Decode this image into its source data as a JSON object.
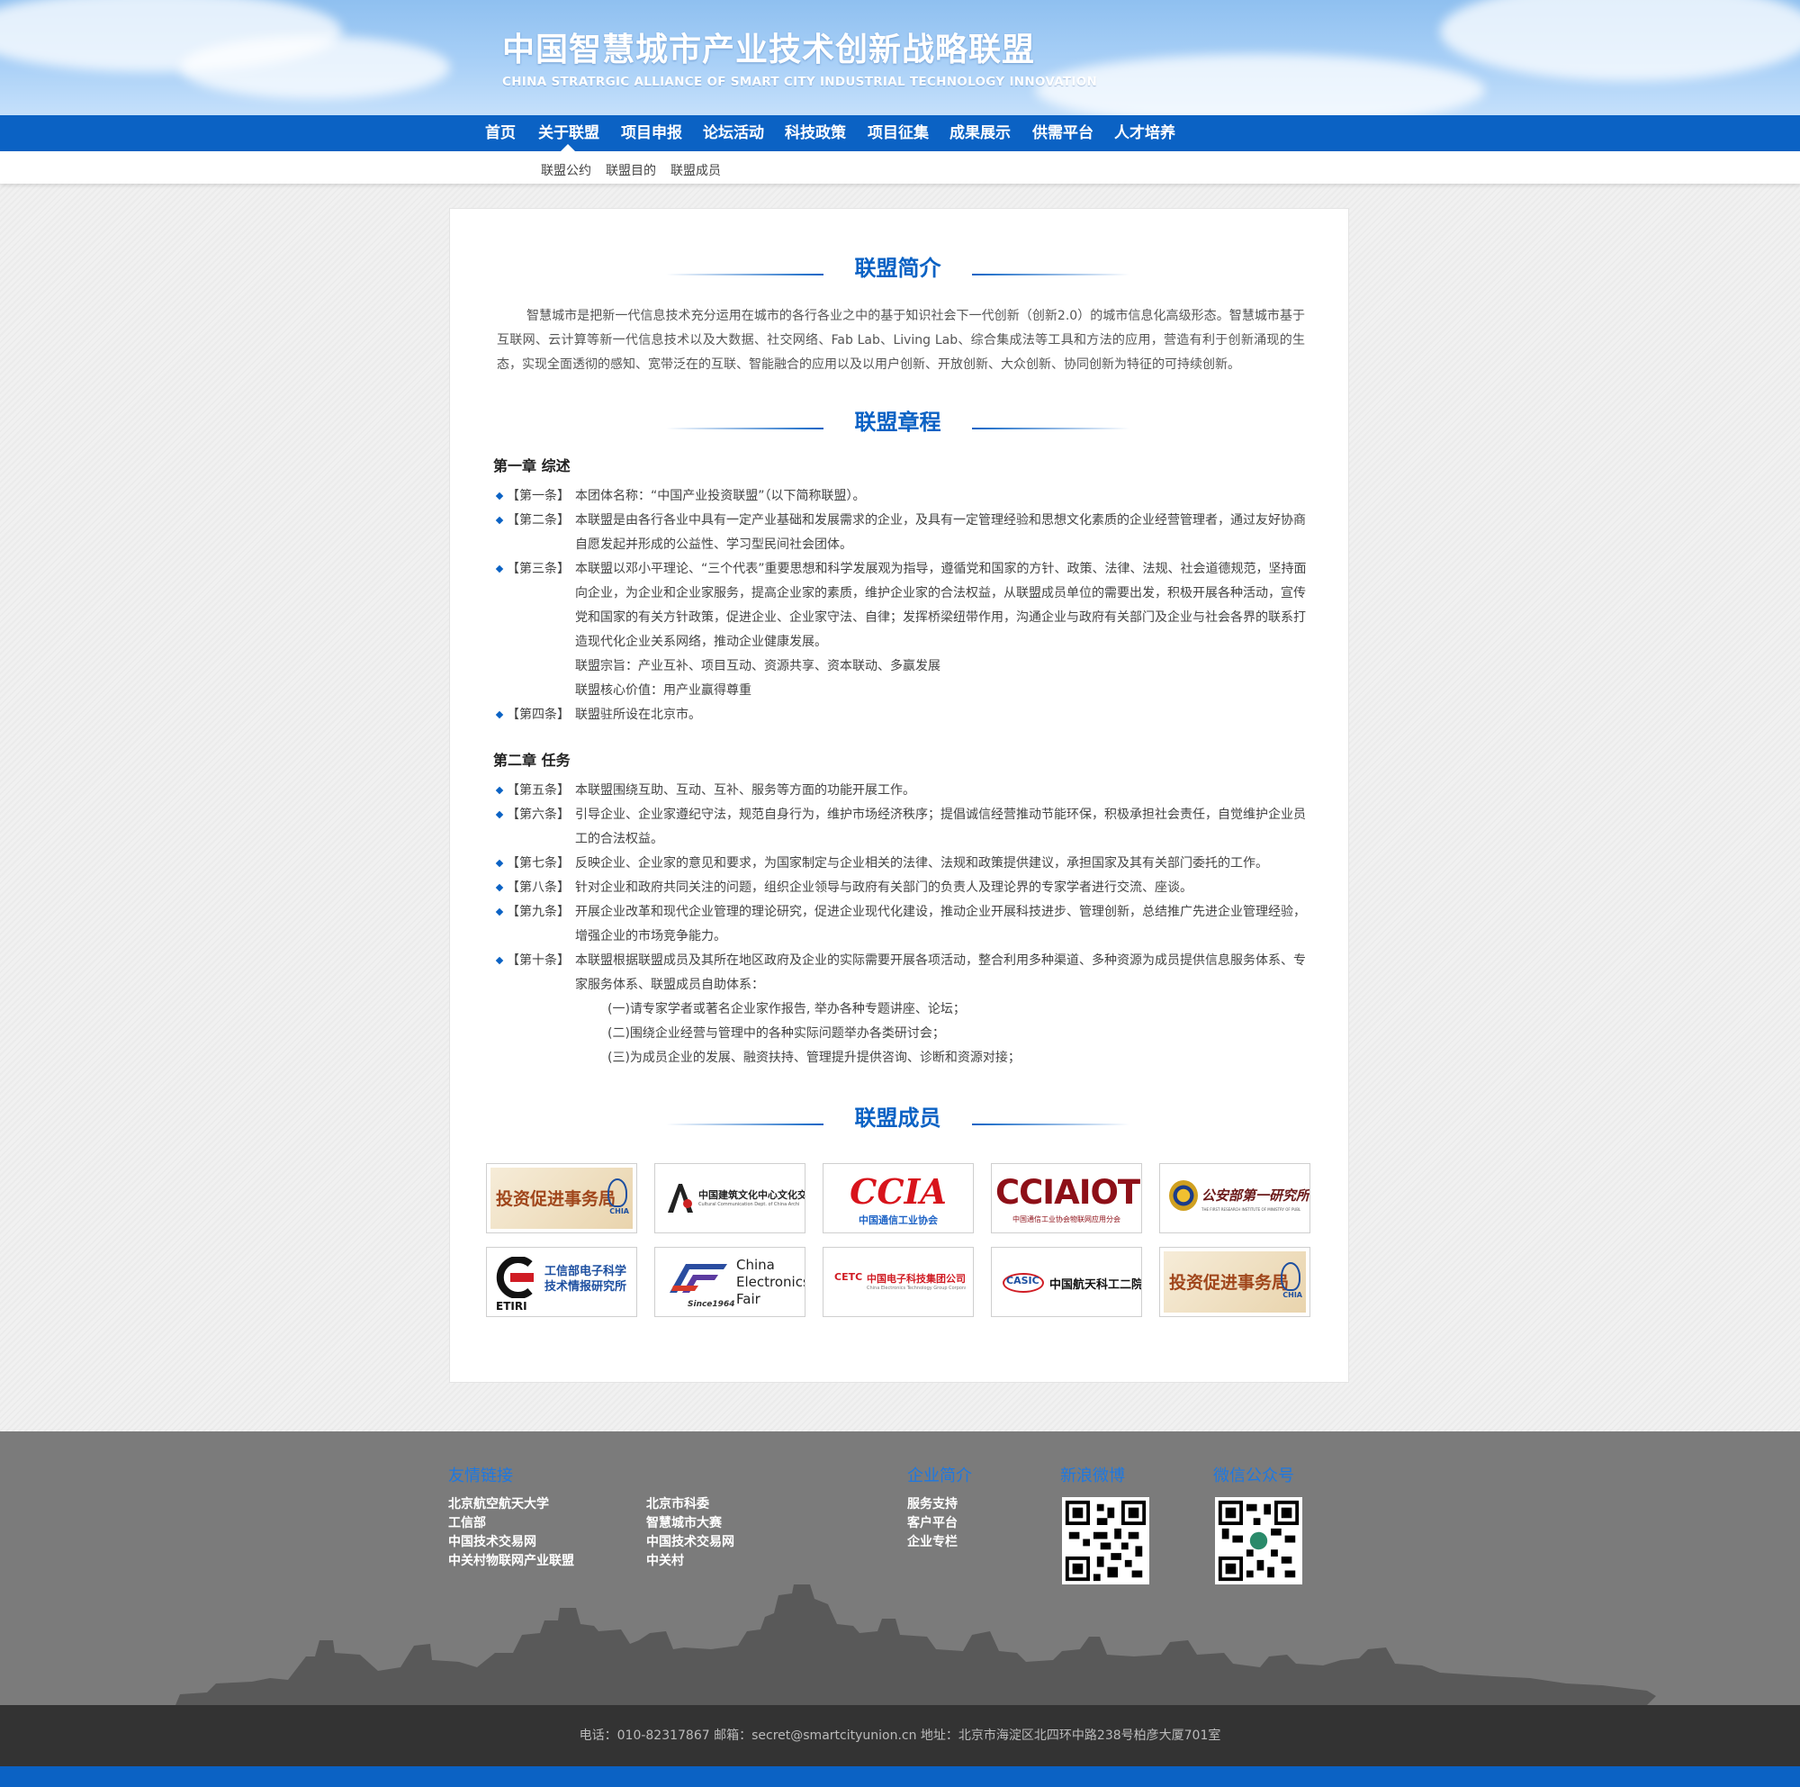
{
  "header": {
    "title": "中国智慧城市产业技术创新战略联盟",
    "subtitle": "CHINA STRATRGIC ALLIANCE OF SMART CITY INDUSTRIAL TECHNOLOGY INNOVATION"
  },
  "nav": {
    "items": [
      "首页",
      "关于联盟",
      "项目申报",
      "论坛活动",
      "科技政策",
      "项目征集",
      "成果展示",
      "供需平台",
      "人才培养"
    ],
    "active": "关于联盟",
    "sub_items": [
      "联盟公约",
      "联盟目的",
      "联盟成员"
    ]
  },
  "intro": {
    "heading": "联盟简介",
    "text": "智慧城市是把新一代信息技术充分运用在城市的各行各业之中的基于知识社会下一代创新（创新2.0）的城市信息化高级形态。智慧城市基于互联网、云计算等新一代信息技术以及大数据、社交网络、Fab Lab、Living Lab、综合集成法等工具和方法的应用，营造有利于创新涌现的生态，实现全面透彻的感知、宽带泛在的互联、智能融合的应用以及以用户创新、开放创新、大众创新、协同创新为特征的可持续创新。"
  },
  "charter": {
    "heading": "联盟章程",
    "chapter1": "第一章  综述",
    "chapter2": "第二章  任务",
    "articles": [
      {
        "num": "【第一条】",
        "text": "本团体名称：“中国产业投资联盟”（以下简称联盟）。"
      },
      {
        "num": "【第二条】",
        "text": "本联盟是由各行各业中具有一定产业基础和发展需求的企业，及具有一定管理经验和思想文化素质的企业经营管理者，通过友好协商自愿发起并形成的公益性、学习型民间社会团体。"
      },
      {
        "num": "【第三条】",
        "text": "本联盟以邓小平理论、“三个代表”重要思想和科学发展观为指导，遵循党和国家的方针、政策、法律、法规、社会道德规范，坚持面向企业，为企业和企业家服务，提高企业家的素质，维护企业家的合法权益，从联盟成员单位的需要出发，积极开展各种活动，宣传党和国家的有关方针政策，促进企业、企业家守法、自律；发挥桥梁纽带作用，沟通企业与政府有关部门及企业与社会各界的联系打造现代化企业关系网络，推动企业健康发展。"
      },
      {
        "num": "【第四条】",
        "text": "联盟驻所设在北京市。"
      },
      {
        "num": "【第五条】",
        "text": "本联盟围绕互助、互动、互补、服务等方面的功能开展工作。"
      },
      {
        "num": "【第六条】",
        "text": "引导企业、企业家遵纪守法，规范自身行为，维护市场经济秩序；提倡诚信经营推动节能环保，积极承担社会责任，自觉维护企业员工的合法权益。"
      },
      {
        "num": "【第七条】",
        "text": "反映企业、企业家的意见和要求，为国家制定与企业相关的法律、法规和政策提供建议，承担国家及其有关部门委托的工作。"
      },
      {
        "num": "【第八条】",
        "text": "针对企业和政府共同关注的问题，组织企业领导与政府有关部门的负责人及理论界的专家学者进行交流、座谈。"
      },
      {
        "num": "【第九条】",
        "text": "开展企业改革和现代企业管理的理论研究，促进企业现代化建设，推动企业开展科技进步、管理创新，总结推广先进企业管理经验，增强企业的市场竞争能力。"
      },
      {
        "num": "【第十条】",
        "text": "本联盟根据联盟成员及其所在地区政府及企业的实际需要开展各项活动，整合利用多种渠道、多种资源为成员提供信息服务体系、专家服务体系、联盟成员自助体系："
      }
    ],
    "purpose": "联盟宗旨：产业互补、项目互动、资源共享、资本联动、多赢发展",
    "core_value": "联盟核心价值：用产业赢得尊重",
    "sub_items": [
      "(一)请专家学者或著名企业家作报告, 举办各种专题讲座、论坛；",
      "(二)围绕企业经营与管理中的各种实际问题举办各类研讨会；",
      "(三)为成员企业的发展、融资扶持、管理提升提供咨询、诊断和资源对接；"
    ]
  },
  "members": {
    "heading": "联盟成员",
    "logos": [
      {
        "name": "投资促进事务局",
        "text": "投资促进事务局",
        "small": "CHIA"
      },
      {
        "name": "中国建筑文化中心",
        "text": "中国建筑文化中心文化交流部",
        "small": "Cultural Communication Dept. of China Architectural Culture Center"
      },
      {
        "name": "中国通信工业协会",
        "text": "CCIA",
        "small": "中国通信工业协会"
      },
      {
        "name": "中国通信工业协会物联网应用分会",
        "text": "CCIAIOT",
        "small": "中国通信工业协会物联网应用分会"
      },
      {
        "name": "公安部第一研究所",
        "text": "公安部第一研究所",
        "small": "THE FIRST RESEARCH INSTITUTE OF MINISTRY OF PUBLIC SECURITY OF P.R.C"
      },
      {
        "name": "工信部电子科学技术情报研究所",
        "text": "工信部电子科学技术情报研究所",
        "small": "ETIRI"
      },
      {
        "name": "China Electronics Fair",
        "text": "China Electronics Fair",
        "small": "Since1964"
      },
      {
        "name": "中国电子科技集团公司",
        "text": "中国电子科技集团公司",
        "small": "China Electronics Technology Group Corporation",
        "badge": "CETC"
      },
      {
        "name": "中国航天科工二院",
        "text": "中国航天科工二院",
        "small": "CASIC"
      },
      {
        "name": "投资促进事务局",
        "text": "投资促进事务局",
        "small": "CHIA"
      }
    ]
  },
  "footer": {
    "links_heading": "友情链接",
    "links_col1": [
      "北京航空航天大学",
      "工信部",
      "中国技术交易网",
      "中关村物联网产业联盟"
    ],
    "links_col2": [
      "北京市科委",
      "智慧城市大赛",
      "中国技术交易网",
      "中关村"
    ],
    "company_heading": "企业简介",
    "company_links": [
      "服务支持",
      "客户平台",
      "企业专栏"
    ],
    "weibo_heading": "新浪微博",
    "wechat_heading": "微信公众号",
    "contact": "电话：010-82317867 邮箱：secret@smartcityunion.cn 地址：北京市海淀区北四环中路238号柏彦大厦701室"
  },
  "colors": {
    "brand_blue": "#0b62c4",
    "footer_gray": "#7b7b7b",
    "bottom_bar": "#333333"
  }
}
